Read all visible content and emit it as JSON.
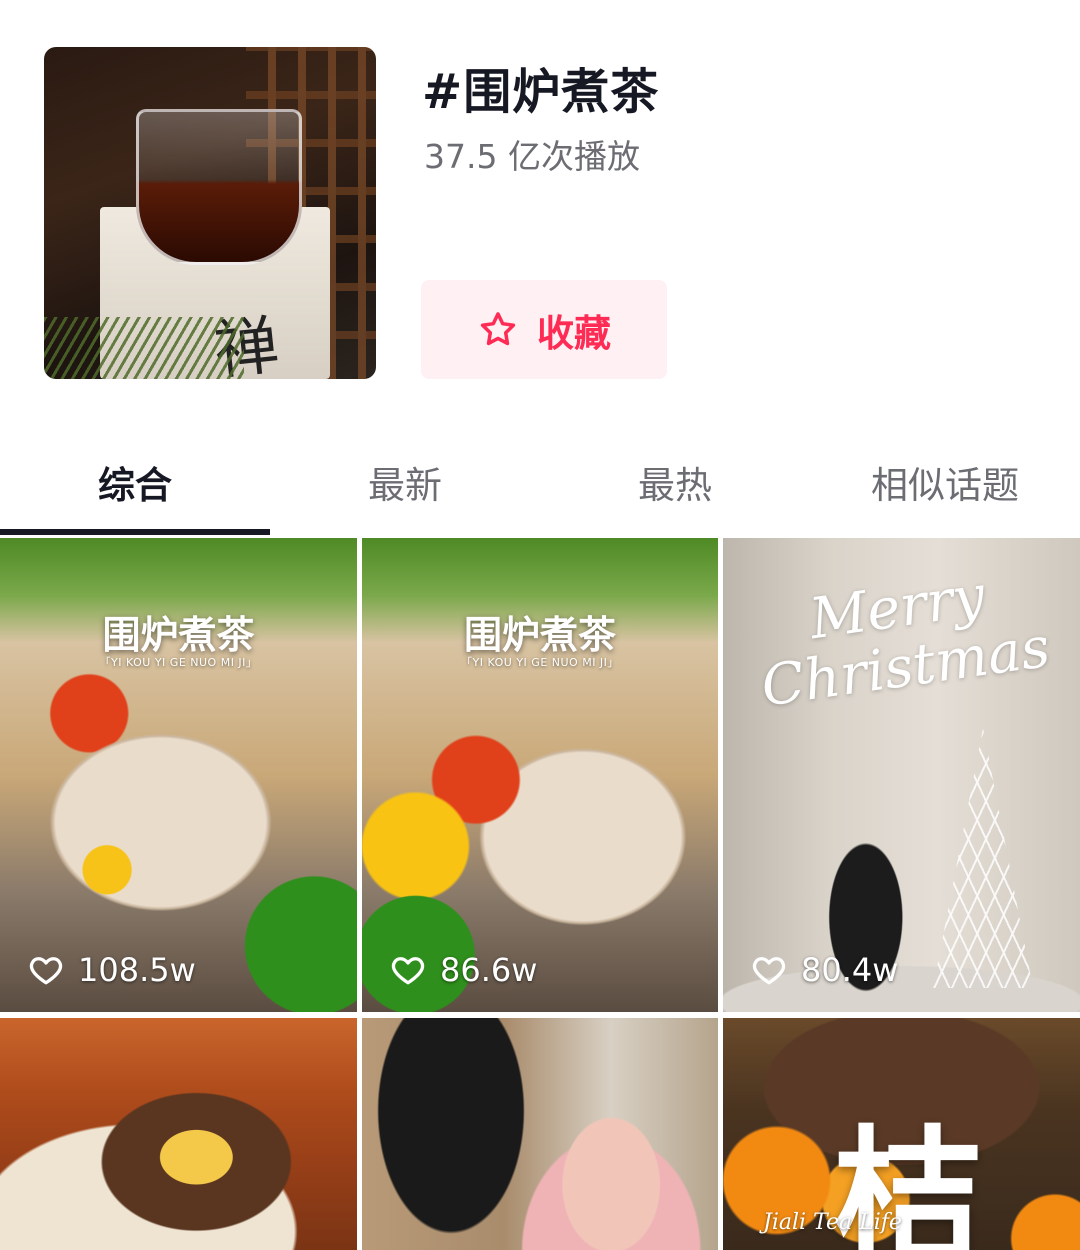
{
  "topic": {
    "title": "#围炉煮茶",
    "play_count": "37.5 亿次播放",
    "favorite_label": "收藏",
    "accent_color": "#fe2c55"
  },
  "tabs": [
    {
      "label": "综合",
      "active": true
    },
    {
      "label": "最新",
      "active": false
    },
    {
      "label": "最热",
      "active": false
    },
    {
      "label": "相似话题",
      "active": false
    }
  ],
  "videos": [
    {
      "likes": "108.5w",
      "overlay_title": "围炉煮茶",
      "overlay_sub": "「YI KOU YI GE NUO MI JI」"
    },
    {
      "likes": "86.6w",
      "overlay_title": "围炉煮茶",
      "overlay_sub": "「YI KOU YI GE NUO MI JI」"
    },
    {
      "likes": "80.4w",
      "overlay_title": "Merry Christmas"
    },
    {},
    {},
    {
      "overlay_title": "桔",
      "overlay_brand": "Jiali Tea Life"
    }
  ]
}
